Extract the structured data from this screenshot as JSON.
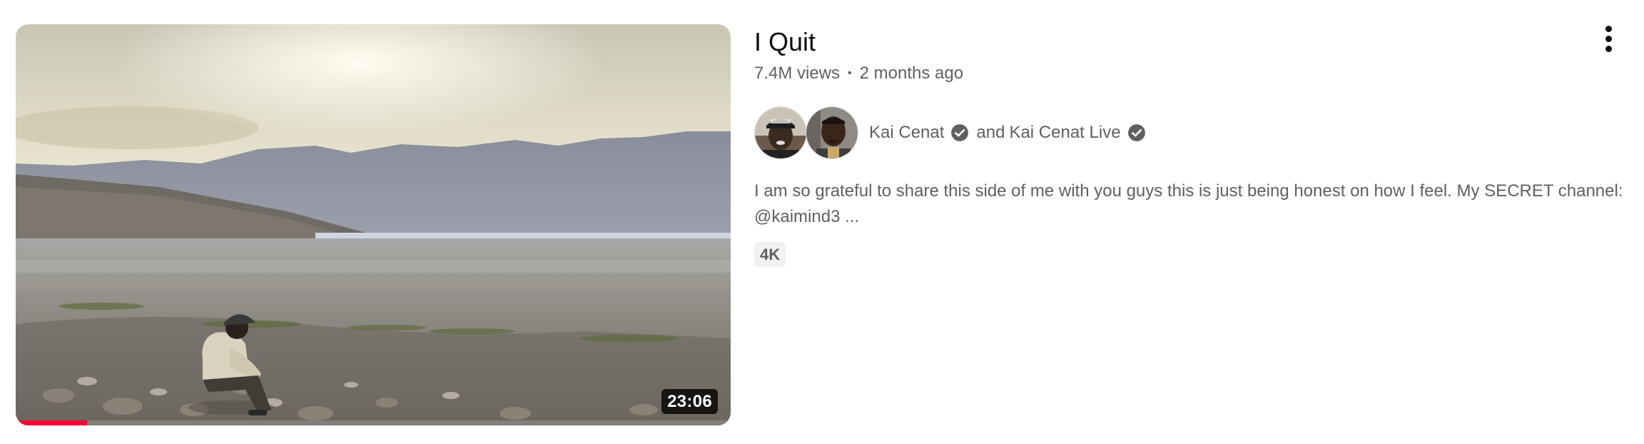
{
  "video": {
    "title": "I Quit",
    "views": "7.4M views",
    "separator": "•",
    "age": "2 months ago",
    "duration": "23:06",
    "watch_progress": 0.1,
    "progress_color": "#ff0033",
    "thumbnail_icon": "video-thumbnail-desert-sunset",
    "badge": "4K"
  },
  "channels": {
    "primary": "Kai Cenat",
    "connector": "and",
    "secondary": "Kai Cenat Live",
    "verified_icon": "verified-check-icon"
  },
  "description": "I am so grateful to share this side of me with you guys this is just being honest on how I feel. My SECRET channel: @kaimind3 ...",
  "menu": {
    "icon": "more-vert-icon"
  }
}
